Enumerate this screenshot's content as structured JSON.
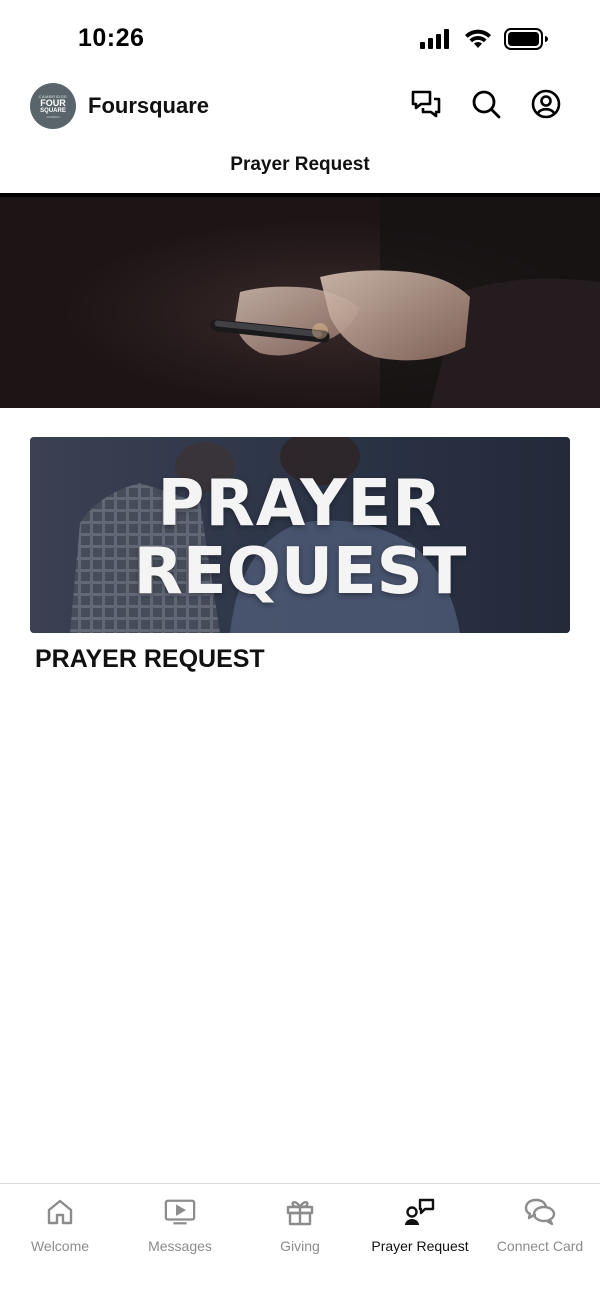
{
  "status_bar": {
    "time": "10:26"
  },
  "header": {
    "logo_lines": [
      "CAMBRIDGE",
      "FOUR",
      "SQUARE",
      "CHURCH"
    ],
    "app_name": "Foursquare",
    "actions": [
      "chat-icon",
      "search-icon",
      "profile-icon"
    ]
  },
  "page": {
    "title": "Prayer Request"
  },
  "card": {
    "image_text_line1": "PRAYER",
    "image_text_line2": "REQUEST",
    "caption": "PRAYER REQUEST"
  },
  "tabs": [
    {
      "label": "Welcome",
      "icon": "home-icon",
      "active": false
    },
    {
      "label": "Messages",
      "icon": "video-icon",
      "active": false
    },
    {
      "label": "Giving",
      "icon": "gift-icon",
      "active": false
    },
    {
      "label": "Prayer Request",
      "icon": "prayer-icon",
      "active": true
    },
    {
      "label": "Connect Card",
      "icon": "connect-icon",
      "active": false
    }
  ],
  "colors": {
    "active": "#111111",
    "inactive": "#8c8c8c",
    "logo_bg": "#59656b"
  }
}
